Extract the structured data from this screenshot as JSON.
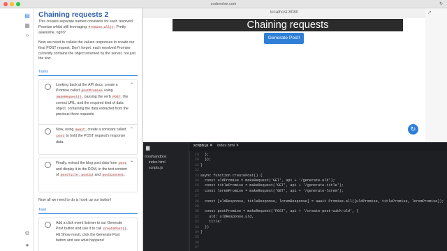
{
  "window": {
    "url": "codevolve.com",
    "refresh_icon": "reload-icon"
  },
  "rail": {
    "icons": [
      "sidebar-icon",
      "layout-icon",
      "code-icon",
      "gear-icon",
      "dot-icon"
    ]
  },
  "lesson": {
    "title": "Chaining requests 2",
    "intro": "This creates separate named constants for each resolved Promise whilst still leveraging Promise.all(). Pretty awesome, right?",
    "intro2": "Now we need to collate the values responses to create our final POST request. Don't forget: each resolved Promise currently contains the object returned by the server, not just the text.",
    "tasks_heading": "Tasks",
    "tasks": [
      "Looking back at the API docs, create a Promise called postPromise using makeRequest(), passing the verb POST, the correct URL, and the required kind of data object, containing the data extracted from the previous three requests.",
      "Now, using await, create a constant called post to hold the POST request's response data.",
      "Finally, extract the blog post data from post and display it in the DOM, in the text content of postTitle, postId and postContent."
    ],
    "outro": "Now all we need to do is hook up our button!",
    "task_heading": "Task",
    "final_task": "Add a click event listener to our Generate Post button and use it to call createPost(). Hit Show result, click the Generate Post button and see what happens!"
  },
  "preview": {
    "location": "localhost:8080",
    "heading": "Chaining requests",
    "button": "Generate Post!"
  },
  "ide": {
    "folder": "/root/sandbox",
    "files": [
      "index.html",
      "scripts.js"
    ],
    "tabs": [
      "scripts.js",
      "index.html"
    ],
    "line_numbers": [
      "19",
      "20",
      "21",
      "22",
      "23",
      "24",
      "25",
      "26",
      "27",
      "28",
      "29",
      "30",
      "31",
      "32",
      "33",
      "34",
      "35",
      "36",
      "37"
    ],
    "lines": [
      "  };",
      "  });",
      "}",
      "",
      "async function createPost() {",
      "  const uldPromise = makeRequest('GET', api + '/generate-uld');",
      "  const titlePromise = makeRequest('GET', api + '/generate-title');",
      "  const loremPromise = makeRequest('GET', api + '/generate-lorem');",
      "",
      "  const [uldResponse, titleResponse, loremResponse] = await Promise.all([uldPromise, titlePromise, loremPromise]);",
      "",
      "  const postPromise = makeRequest('POST', api + '/create-post-with-uld', {",
      "    uld: uldResponse.uld,",
      "    title:",
      "  })",
      "}",
      "",
      "",
      ""
    ]
  },
  "colors": {
    "accent": "#2f7fd8",
    "title": "#2c5da8",
    "banner": "#2b2b2b",
    "editor_bg": "#1e1f22"
  }
}
